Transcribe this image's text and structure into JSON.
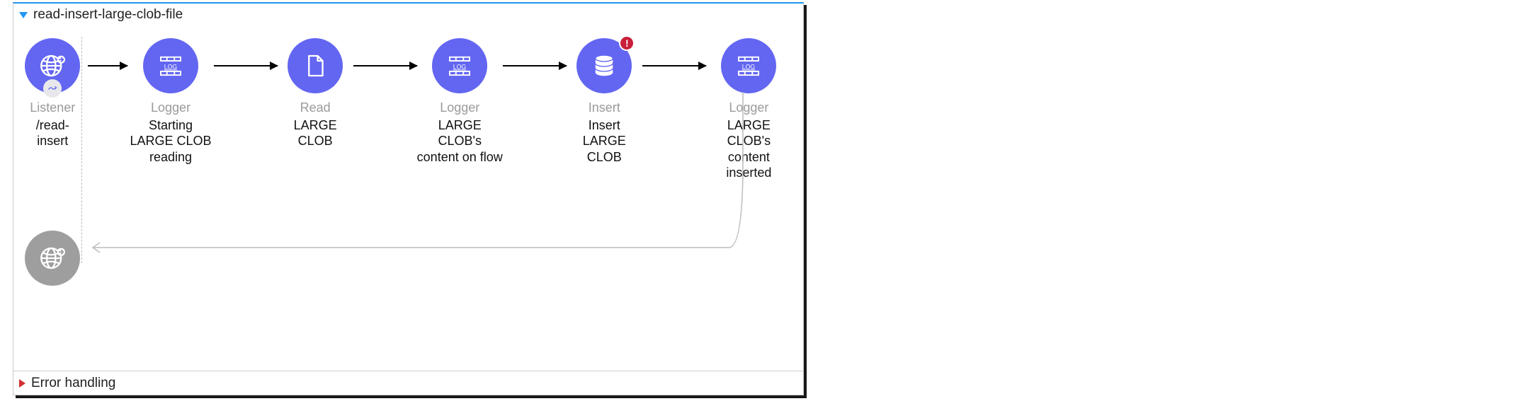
{
  "flow": {
    "name": "read-insert-large-clob-file",
    "errorSectionLabel": "Error handling",
    "nodes": [
      {
        "type": "Listener",
        "label": "/read-insert",
        "icon": "globe-icon",
        "hasPlug": true
      },
      {
        "type": "Logger",
        "label": "Starting LARGE CLOB reading",
        "icon": "log-icon"
      },
      {
        "type": "Read",
        "label": "LARGE CLOB",
        "icon": "file-icon"
      },
      {
        "type": "Logger",
        "label": "LARGE CLOB's content on flow",
        "icon": "log-icon"
      },
      {
        "type": "Insert",
        "label": "Insert LARGE CLOB",
        "icon": "database-icon",
        "hasError": true
      },
      {
        "type": "Logger",
        "label": "LARGE CLOB's content inserted",
        "icon": "log-icon"
      }
    ]
  }
}
